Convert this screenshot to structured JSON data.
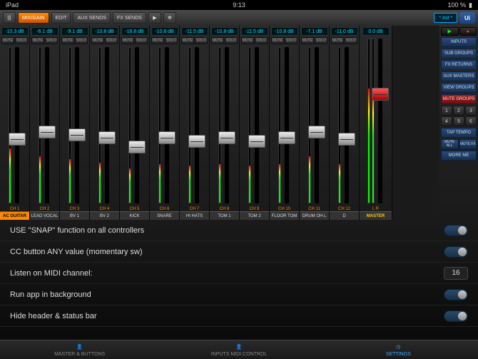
{
  "status": {
    "carrier": "iPad",
    "wifi": "●●●",
    "time": "9:13",
    "battery": "100 %"
  },
  "header": {
    "meters_icon": "|||",
    "mix_gain": "MIX/GAIN",
    "edit": "EDIT",
    "aux_sends": "AUX SENDS",
    "fx_sends": "FX SENDS",
    "play": "▶",
    "gear": "✻",
    "preset": "* Init *",
    "logo": "Ui"
  },
  "channels": [
    {
      "db": "-10.3 dB",
      "mute": "MUTE",
      "solo": "SOLO",
      "meter": 35,
      "fader": 55,
      "num": "CH 1",
      "label": "AC GUITAR",
      "selected": true
    },
    {
      "db": "-6.1 dB",
      "mute": "MUTE",
      "solo": "SOLO",
      "meter": 30,
      "fader": 50,
      "num": "CH 2",
      "label": "LEAD VOCAL"
    },
    {
      "db": "-9.1 dB",
      "mute": "MUTE",
      "solo": "SOLO",
      "meter": 28,
      "fader": 52,
      "num": "CH 3",
      "label": "BV 1"
    },
    {
      "db": "-10.8 dB",
      "mute": "MUTE",
      "solo": "SOLO",
      "meter": 26,
      "fader": 54,
      "num": "CH 4",
      "label": "BV 2"
    },
    {
      "db": "-16.8 dB",
      "mute": "MUTE",
      "solo": "SOLO",
      "meter": 22,
      "fader": 60,
      "num": "CH 5",
      "label": "KICK"
    },
    {
      "db": "-10.8 dB",
      "mute": "MUTE",
      "solo": "SOLO",
      "meter": 25,
      "fader": 54,
      "num": "CH 6",
      "label": "SNARE"
    },
    {
      "db": "-11.5 dB",
      "mute": "MUTE",
      "solo": "SOLO",
      "meter": 24,
      "fader": 56,
      "num": "CH 7",
      "label": "HI HATS"
    },
    {
      "db": "-10.8 dB",
      "mute": "MUTE",
      "solo": "SOLO",
      "meter": 25,
      "fader": 54,
      "num": "CH 8",
      "label": "TOM 1"
    },
    {
      "db": "-11.5 dB",
      "mute": "MUTE",
      "solo": "SOLO",
      "meter": 24,
      "fader": 56,
      "num": "CH 9",
      "label": "TOM 2"
    },
    {
      "db": "-10.8 dB",
      "mute": "MUTE",
      "solo": "SOLO",
      "meter": 25,
      "fader": 54,
      "num": "CH 10",
      "label": "FLOOR TOM"
    },
    {
      "db": "-7.1 dB",
      "mute": "MUTE",
      "solo": "SOLO",
      "meter": 30,
      "fader": 50,
      "num": "CH 11",
      "label": "DRUM OH L"
    },
    {
      "db": "-11.0 dB",
      "mute": "MUTE",
      "solo": "SOLO",
      "meter": 25,
      "fader": 55,
      "num": "CH 12",
      "label": "D"
    }
  ],
  "master": {
    "db": "0.0 dB",
    "meter_l": 70,
    "meter_r": 68,
    "fader": 30,
    "num": "L  R",
    "label": "MASTER"
  },
  "transport": {
    "play": "▶",
    "rec": "●"
  },
  "sidebar": {
    "inputs": "INPUTS",
    "sub_groups": "SUB GROUPS",
    "fx_returns": "FX RETURNS",
    "aux_masters": "AUX MASTERS",
    "view_groups": "VIEW GROUPS",
    "mute_groups": "MUTE GROUPS",
    "nums": [
      "1",
      "2",
      "3",
      "4",
      "5",
      "6"
    ],
    "tap_tempo": "TAP TEMPO",
    "mute_all": "MUTE\nALL",
    "mute_fx": "MUTE\nFX",
    "more_me": "MORE ME"
  },
  "settings": [
    {
      "label": "USE \"SNAP\" function on all controllers",
      "type": "toggle"
    },
    {
      "label": "CC button ANY value (momentary sw)",
      "type": "toggle"
    },
    {
      "label": "Listen on MIDI channel:",
      "type": "value",
      "value": "16"
    },
    {
      "label": "Run app in background",
      "type": "toggle"
    },
    {
      "label": "Hide header & status bar",
      "type": "toggle"
    }
  ],
  "tabs": {
    "master_buttons": "MASTER & BUTTONS",
    "inputs_midi": "INPUTS MIDI CONTROL",
    "settings": "SETTINGS"
  }
}
